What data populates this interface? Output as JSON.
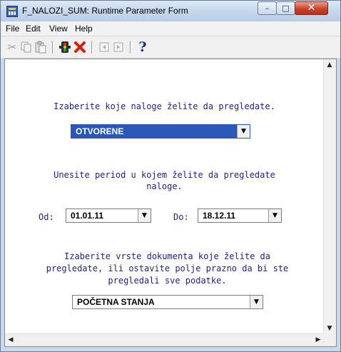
{
  "window": {
    "title": "F_NALOZI_SUM: Runtime Parameter Form",
    "buttons": {
      "minimize": "–",
      "maximize": "□",
      "close": "✕"
    }
  },
  "menu": {
    "items": [
      "File",
      "Edit",
      "View",
      "Help"
    ]
  },
  "toolbar": {
    "icons": [
      "cut-icon",
      "copy-icon",
      "paste-icon",
      "run-icon",
      "cancel-icon",
      "previous-icon",
      "next-icon",
      "help-icon"
    ],
    "help_glyph": "?"
  },
  "form": {
    "prompt_nalozi": "Izaberite koje naloge želite da pregledate.",
    "nalozi_value": "OTVORENE",
    "prompt_period_line1": "Unesite period u kojem želite da pregledate",
    "prompt_period_line2": "naloge.",
    "od_label": "Od:",
    "od_value": "01.01.11",
    "do_label": "Do:",
    "do_value": "18.12.11",
    "prompt_dok_line1": "Izaberite vrste dokumenta koje želite da",
    "prompt_dok_line2": "pregledate, ili ostavite polje prazno da bi ste",
    "prompt_dok_line3": "pregledali sve podatke.",
    "dokument_value": "POČETNA STANJA"
  },
  "colors": {
    "prompt": "#1f237a",
    "selected": "#2a57b8",
    "close": "#c8422c"
  }
}
